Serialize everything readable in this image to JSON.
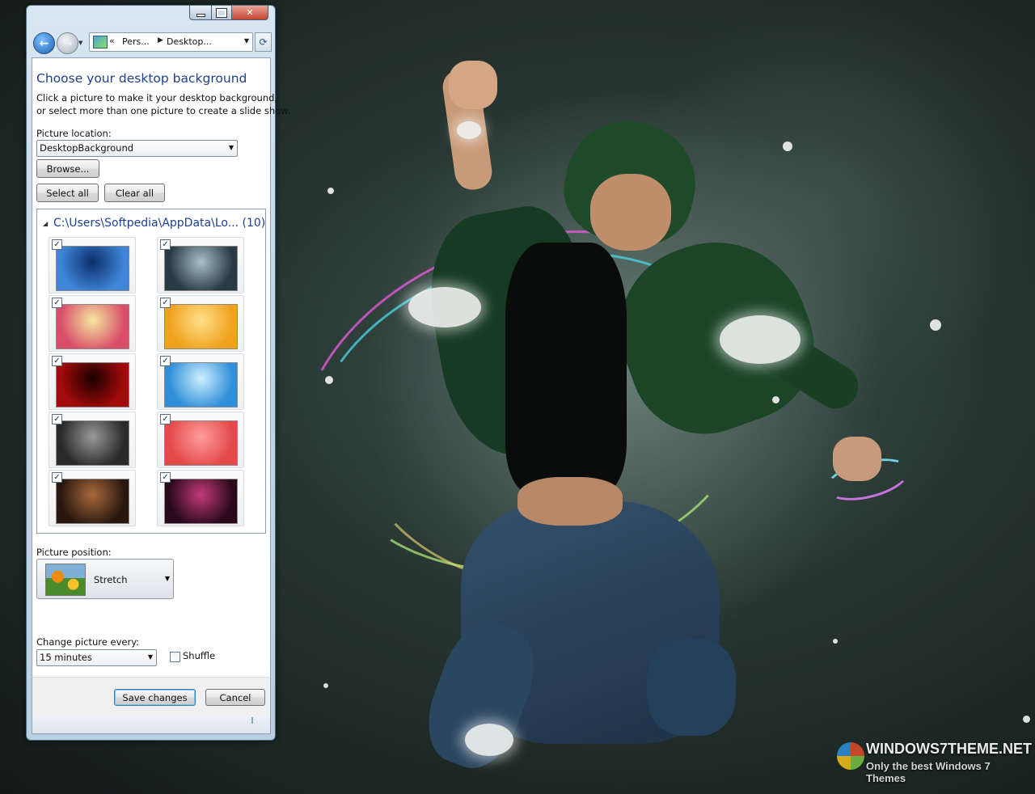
{
  "window": {
    "breadcrumb": [
      "Pers...",
      "Desktop..."
    ],
    "caption_buttons": {
      "minimize": "minimize-icon",
      "maximize": "maximize-icon",
      "close": "close-icon"
    }
  },
  "content": {
    "title": "Choose your desktop background",
    "instructions_line1": "Click a picture to make it your desktop background,",
    "instructions_line2": "or select more than one picture to create a slide show.",
    "location_label": "Picture location:",
    "location_value": "DesktopBackground",
    "browse_label": "Browse...",
    "select_all_label": "Select all",
    "clear_all_label": "Clear all",
    "folder_header": "C:\\Users\\Softpedia\\AppData\\Lo... (10)",
    "thumbnails": [
      {
        "checked": true,
        "colors": [
          "#3f86d8",
          "#0b2e6a"
        ]
      },
      {
        "checked": true,
        "colors": [
          "#2a3a44",
          "#a7c0c8"
        ]
      },
      {
        "checked": true,
        "colors": [
          "#d94f6a",
          "#f5e7a0"
        ]
      },
      {
        "checked": true,
        "colors": [
          "#f0a21e",
          "#ffe08a"
        ]
      },
      {
        "checked": true,
        "colors": [
          "#a30a0a",
          "#1a0000"
        ]
      },
      {
        "checked": true,
        "colors": [
          "#2f8fd8",
          "#cfefff"
        ]
      },
      {
        "checked": true,
        "colors": [
          "#2a2a2a",
          "#9a9a9a"
        ]
      },
      {
        "checked": true,
        "colors": [
          "#e44a4a",
          "#ff9c9c"
        ]
      },
      {
        "checked": true,
        "colors": [
          "#2a1810",
          "#a8693c"
        ]
      },
      {
        "checked": true,
        "colors": [
          "#2a0a1a",
          "#c23a7a"
        ]
      }
    ],
    "position_label": "Picture position:",
    "position_value": "Stretch",
    "change_label": "Change picture every:",
    "interval_value": "15 minutes",
    "shuffle_label": "Shuffle",
    "shuffle_checked": false,
    "save_label": "Save changes",
    "cancel_label": "Cancel"
  },
  "watermark": {
    "title": "WINDOWS7THEME.NET",
    "subtitle": "Only the best Windows 7 Themes"
  }
}
